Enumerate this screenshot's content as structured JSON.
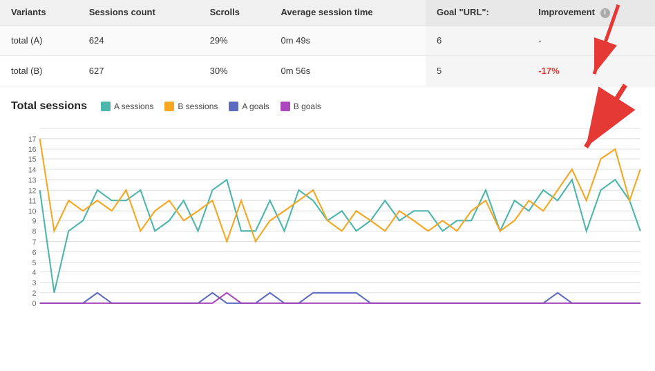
{
  "table": {
    "headers": [
      "Variants",
      "Sessions count",
      "Scrolls",
      "Average session time",
      "Goal \"URL\":",
      "Improvement"
    ],
    "rows": [
      {
        "variant": "total (A)",
        "sessions_count": "624",
        "scrolls": "29%",
        "avg_session_time": "0m 49s",
        "goal_url": "6",
        "improvement": "-"
      },
      {
        "variant": "total (B)",
        "sessions_count": "627",
        "scrolls": "30%",
        "avg_session_time": "0m 56s",
        "goal_url": "5",
        "improvement": "-17%"
      }
    ]
  },
  "chart": {
    "title": "Total sessions",
    "legend": [
      {
        "label": "A sessions",
        "color": "#4db6ac",
        "type": "line"
      },
      {
        "label": "B sessions",
        "color": "#f5a623",
        "type": "line"
      },
      {
        "label": "A goals",
        "color": "#5c6bc0",
        "type": "line"
      },
      {
        "label": "B goals",
        "color": "#ab47bc",
        "type": "line"
      }
    ],
    "y_axis": [
      0,
      2,
      3,
      4,
      5,
      6,
      7,
      8,
      9,
      10,
      11,
      12,
      13,
      14,
      15,
      16,
      17
    ],
    "info_icon_label": "i"
  }
}
